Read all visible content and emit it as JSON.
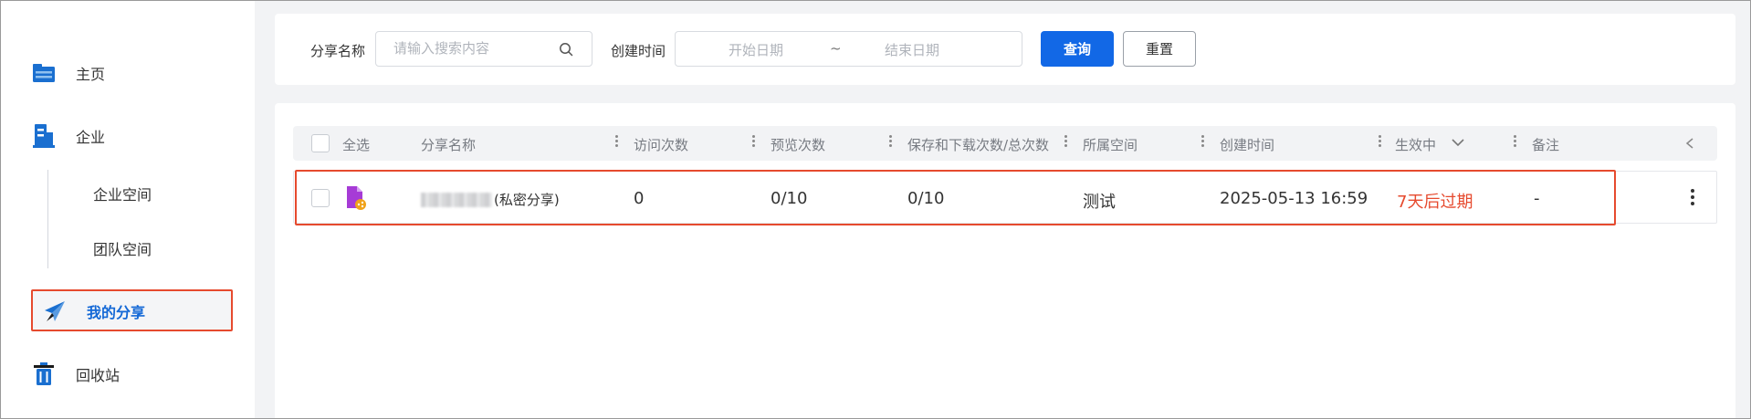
{
  "sidebar": {
    "items": [
      {
        "label": "主页",
        "icon": "folder-icon"
      },
      {
        "label": "企业",
        "icon": "building-icon"
      },
      {
        "label": "企业空间"
      },
      {
        "label": "团队空间"
      },
      {
        "label": "我的分享",
        "icon": "paper-plane-icon",
        "active": true
      },
      {
        "label": "回收站",
        "icon": "trash-icon"
      }
    ]
  },
  "filter": {
    "share_name_label": "分享名称",
    "search_placeholder": "请输入搜索内容",
    "search_value": "",
    "created_label": "创建时间",
    "start_date_placeholder": "开始日期",
    "separator": "~",
    "end_date_placeholder": "结束日期",
    "query_label": "查询",
    "reset_label": "重置"
  },
  "table": {
    "headers": {
      "select_all": "全选",
      "name": "分享名称",
      "visits": "访问次数",
      "previews": "预览次数",
      "saves_downloads": "保存和下载次数/总次数",
      "space": "所属空间",
      "created": "创建时间",
      "status": "生效中",
      "remark": "备注"
    },
    "rows": [
      {
        "name_suffix": "(私密分享)",
        "visits": "0",
        "previews": "0/10",
        "saves_downloads": "0/10",
        "space": "测试",
        "created": "2025-05-13 16:59",
        "status": "7天后过期",
        "remark": "-"
      }
    ]
  },
  "colors": {
    "accent": "#1268e6",
    "highlight_border": "#e64a2e",
    "expire_text": "#e64a2e"
  }
}
